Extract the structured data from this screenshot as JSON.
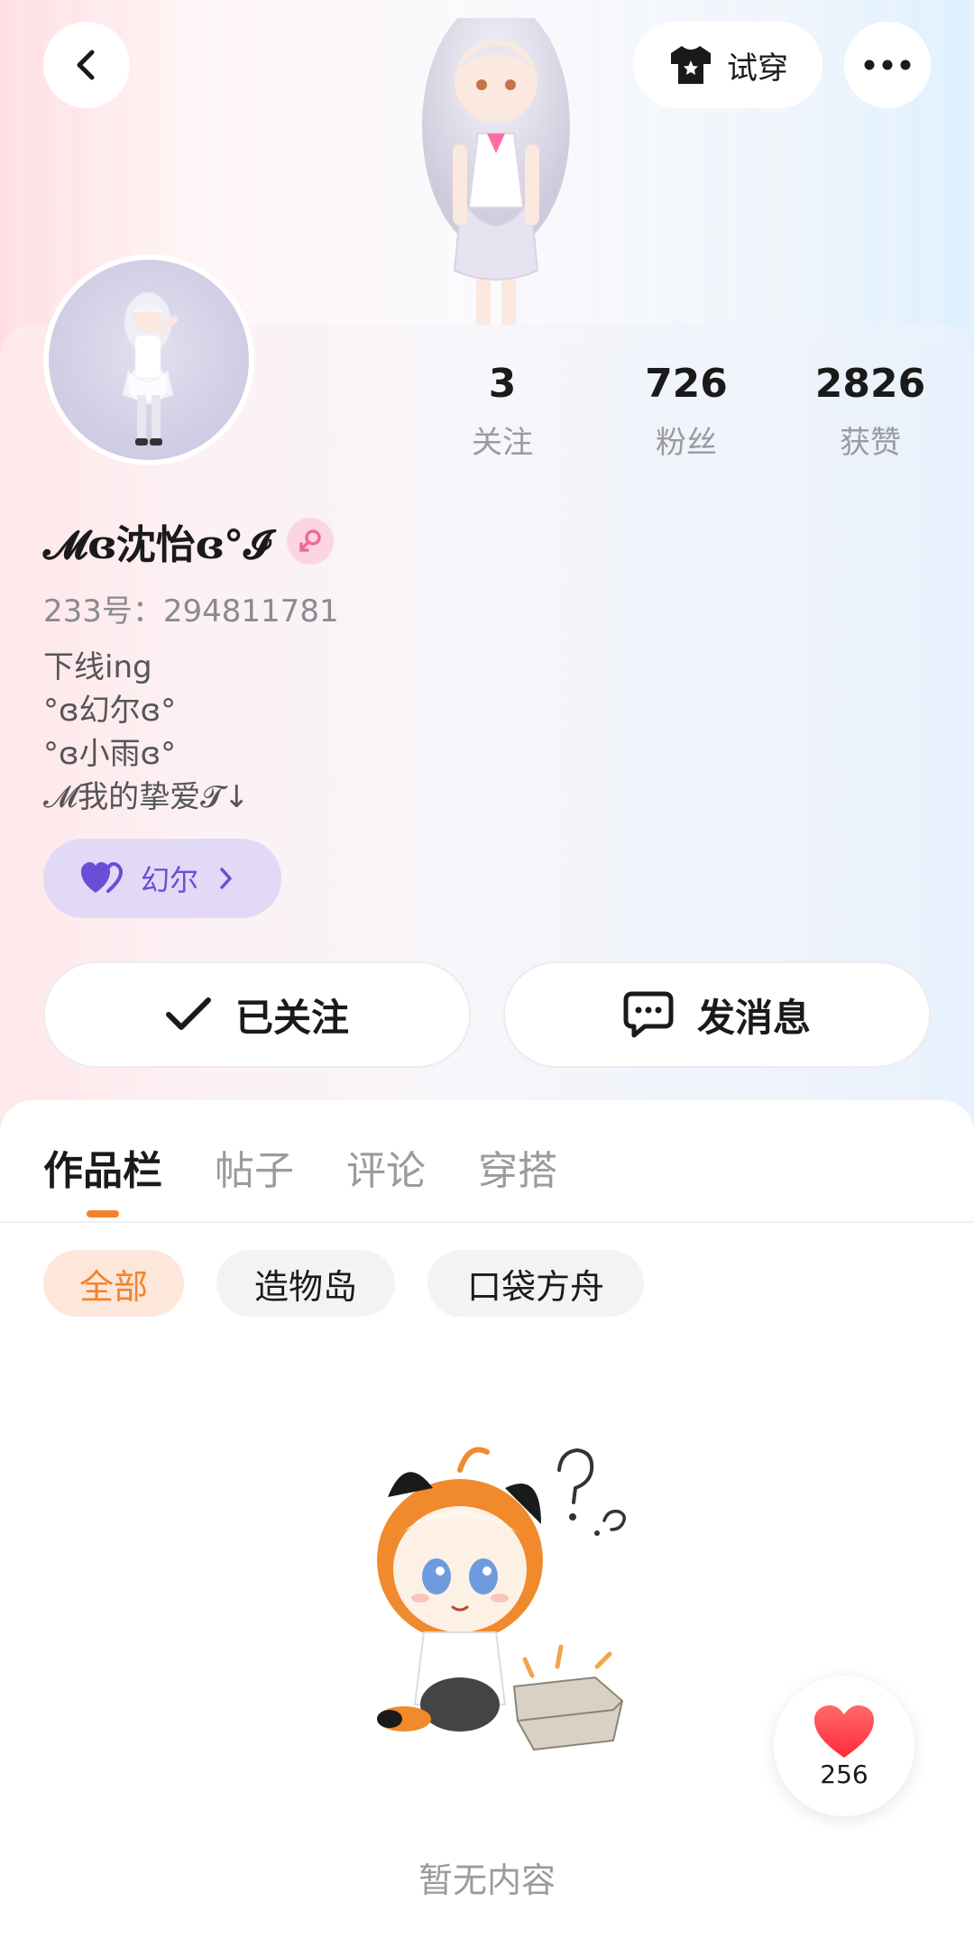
{
  "header": {
    "tryon_label": "试穿",
    "icons": {
      "back": "chevron-left-icon",
      "more": "more-dots-icon",
      "tryon": "shirt-star-icon"
    }
  },
  "profile": {
    "username": "𝓜ɞ沈怡ɞ°𝓘",
    "gender": "female",
    "uid_text": "233号：294811781",
    "bio_lines": [
      "下线ing",
      "°ɞ幻尔ɞ°",
      "°ɞ小雨ɞ°",
      "𝓜我的挚爱𝓣↓"
    ],
    "partner_label": "幻尔"
  },
  "stats": {
    "following": {
      "value": "3",
      "label": "关注"
    },
    "fans": {
      "value": "726",
      "label": "粉丝"
    },
    "likes": {
      "value": "2826",
      "label": "获赞"
    }
  },
  "actions": {
    "follow_label": "已关注",
    "message_label": "发消息"
  },
  "tabs": [
    {
      "label": "作品栏",
      "active": true
    },
    {
      "label": "帖子",
      "active": false
    },
    {
      "label": "评论",
      "active": false
    },
    {
      "label": "穿搭",
      "active": false
    }
  ],
  "filters": [
    {
      "label": "全部",
      "active": true
    },
    {
      "label": "造物岛",
      "active": false
    },
    {
      "label": "口袋方舟",
      "active": false
    }
  ],
  "empty_state": {
    "text": "暂无内容"
  },
  "like_fab": {
    "count": "256"
  },
  "colors": {
    "accent": "#f5822a",
    "partner_purple": "#6a4fd6",
    "heart_red": "#ff3b4a",
    "female_pink": "#f06a9a"
  }
}
